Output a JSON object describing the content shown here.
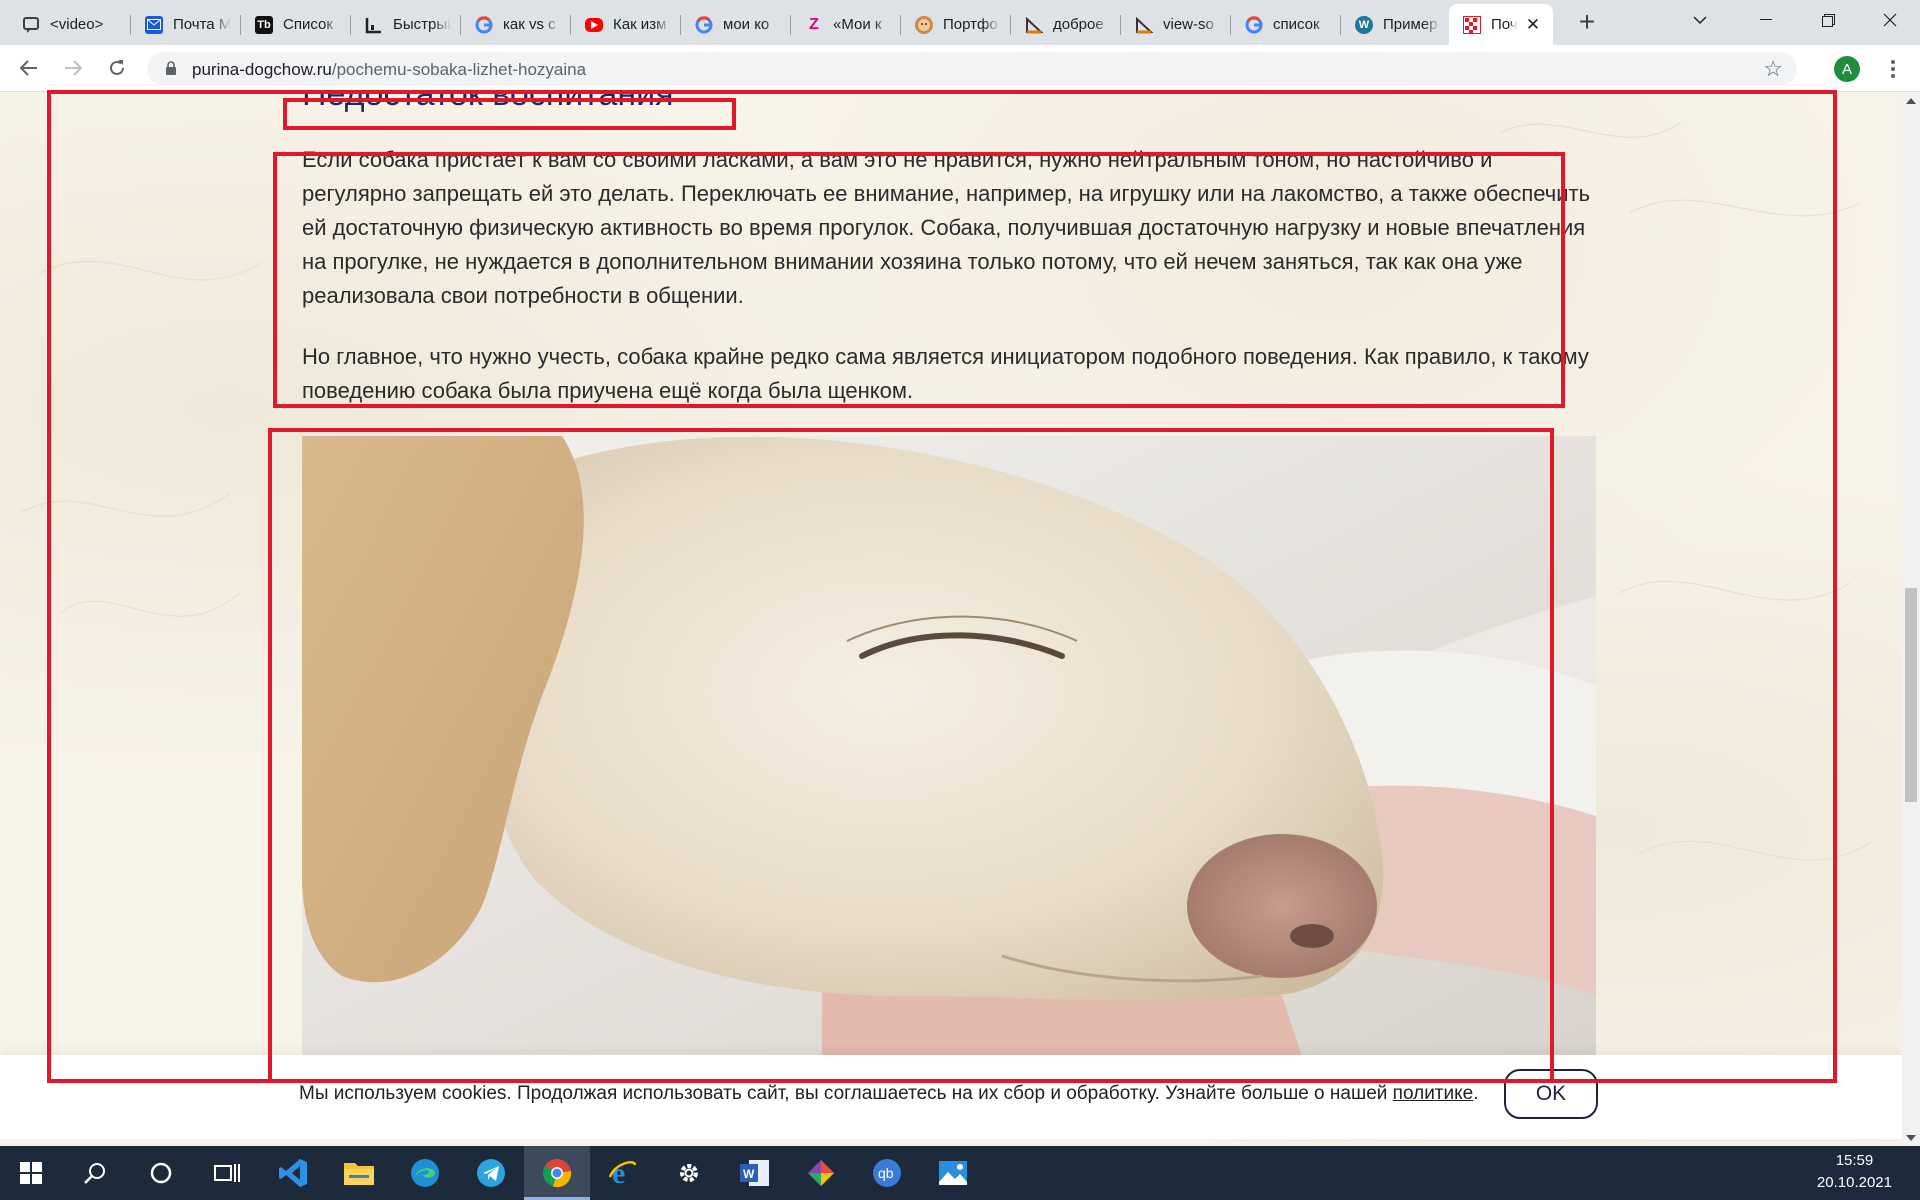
{
  "browser": {
    "tabs": [
      {
        "title": "<video>",
        "icon": "chat-icon"
      },
      {
        "title": "Почта Mail.ru",
        "icon": "mail-icon"
      },
      {
        "title": "Список",
        "icon": "tb-icon"
      },
      {
        "title": "Быстрый",
        "icon": "chart-icon"
      },
      {
        "title": "как vs c",
        "icon": "google-icon"
      },
      {
        "title": "Как изм",
        "icon": "youtube-icon"
      },
      {
        "title": "мои ко",
        "icon": "google-icon"
      },
      {
        "title": "«Мои к",
        "icon": "z-icon"
      },
      {
        "title": "Портфо",
        "icon": "face-icon"
      },
      {
        "title": "доброе",
        "icon": "triangle-icon"
      },
      {
        "title": "view-so",
        "icon": "triangle-icon"
      },
      {
        "title": "список",
        "icon": "google-icon"
      },
      {
        "title": "Пример",
        "icon": "wordpress-icon"
      },
      {
        "title": "Почему",
        "icon": "purina-icon",
        "active": true
      }
    ],
    "new_tab": "+",
    "url_domain": "purina-dogchow.ru",
    "url_path": "/pochemu-sobaka-lizhet-hozyaina",
    "profile_initial": "A"
  },
  "article": {
    "heading": "Недостаток воспитания",
    "paragraph_1": "Если собака пристает к вам со своими ласками, а вам это не нравится, нужно нейтральным тоном, но настойчиво и регулярно запрещать ей это делать. Переключать ее внимание, например, на игрушку или на лакомство, а также обеспечить ей достаточную физическую активность во время прогулок. Собака, получившая достаточную нагрузку и новые впечатления на прогулке, не нуждается в дополнительном внимании хозяина только потому, что ей нечем заняться, так как она уже реализовала свои потребности в общении.",
    "paragraph_2": "Но главное, что нужно учесть, собака крайне редко сама является инициатором подобного поведения. Как правило, к такому поведению собака была приучена ещё когда была щенком."
  },
  "cookie_bar": {
    "text": "Мы используем cookies. Продолжая использовать сайт, вы соглашаетесь на их сбор и обработку. Узнайте больше о нашей ",
    "link": "политике",
    "suffix": ".",
    "button": "OK"
  },
  "taskbar": {
    "apps": [
      "start-icon",
      "search-icon",
      "cortana-icon",
      "task-view-icon",
      "vscode-icon",
      "file-explorer-icon",
      "edge-icon",
      "telegram-icon",
      "chrome-icon",
      "ie-icon",
      "settings-icon",
      "word-icon",
      "git-icon",
      "qbittorrent-icon",
      "photos-icon"
    ],
    "time": "15:59",
    "date": "20.10.2021"
  },
  "colors": {
    "annotation": "#e0182b",
    "heading": "#1f2a5c",
    "page_bg": "#f8f3e8",
    "taskbar": "#1c2a3b"
  }
}
